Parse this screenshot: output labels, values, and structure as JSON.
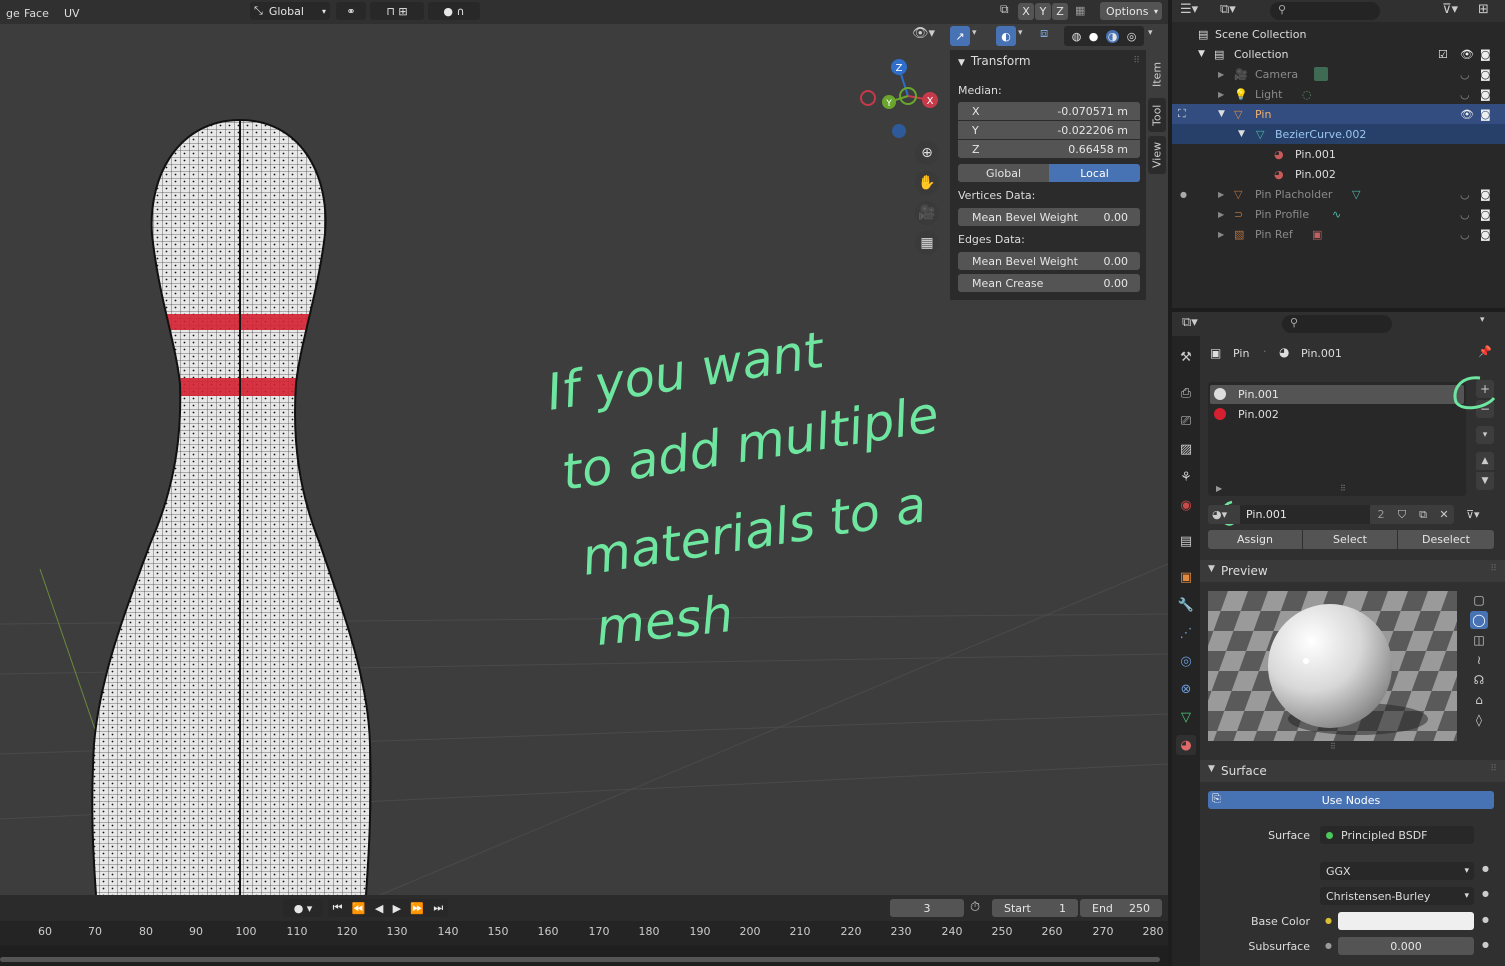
{
  "viewport_header": {
    "menu": [
      "ge",
      "Face",
      "UV"
    ],
    "transform_orientation": "Global",
    "options_label": "Options",
    "axis_x": "X",
    "axis_y": "Y",
    "axis_z": "Z"
  },
  "gizmo": {
    "z": "Z",
    "y": "Y",
    "x": "X"
  },
  "npanel": {
    "tabs": [
      "Item",
      "Tool",
      "View"
    ],
    "section": "Transform",
    "median_label": "Median:",
    "x_label": "X",
    "x_value": "-0.070571 m",
    "y_label": "Y",
    "y_value": "-0.022206 m",
    "z_label": "Z",
    "z_value": "0.66458 m",
    "global_label": "Global",
    "local_label": "Local",
    "vertices_label": "Vertices Data:",
    "mean_bevel_label": "Mean Bevel Weight",
    "mean_bevel_value": "0.00",
    "edges_label": "Edges Data:",
    "edge_bevel_label": "Mean Bevel Weight",
    "edge_bevel_value": "0.00",
    "crease_label": "Mean Crease",
    "crease_value": "0.00"
  },
  "annotation": {
    "line1": "If you want",
    "line2": "to add multiple",
    "line3": "materials to a",
    "line4": "mesh"
  },
  "timeline": {
    "current_frame": "3",
    "start_label": "Start",
    "start_value": "1",
    "end_label": "End",
    "end_value": "250",
    "ticks": [
      "60",
      "70",
      "80",
      "90",
      "100",
      "110",
      "120",
      "130",
      "140",
      "150",
      "160",
      "170",
      "180",
      "190",
      "200",
      "210",
      "220",
      "230",
      "240",
      "250",
      "260",
      "270",
      "280"
    ]
  },
  "outliner": {
    "scene_collection": "Scene Collection",
    "collection": "Collection",
    "camera": "Camera",
    "light": "Light",
    "pin": "Pin",
    "bezier": "BezierCurve.002",
    "mat1": "Pin.001",
    "mat2": "Pin.002",
    "placeholder": "Pin Placholder",
    "profile": "Pin Profile",
    "ref": "Pin Ref"
  },
  "properties": {
    "breadcrumb_object": "Pin",
    "breadcrumb_material": "Pin.001",
    "slots": [
      "Pin.001",
      "Pin.002"
    ],
    "material_name": "Pin.001",
    "user_count": "2",
    "assign_label": "Assign",
    "select_label": "Select",
    "deselect_label": "Deselect",
    "preview_label": "Preview",
    "surface_section": "Surface",
    "use_nodes_label": "Use Nodes",
    "surface_label": "Surface",
    "surface_value": "Principled BSDF",
    "distribution": "GGX",
    "subsurface_method": "Christensen-Burley",
    "base_color_label": "Base Color",
    "subsurface_label": "Subsurface",
    "subsurface_value": "0.000"
  },
  "colors": {
    "accent_blue": "#4772b3",
    "annotation_green": "#6ee6a0",
    "stripe_red": "#d42030"
  }
}
